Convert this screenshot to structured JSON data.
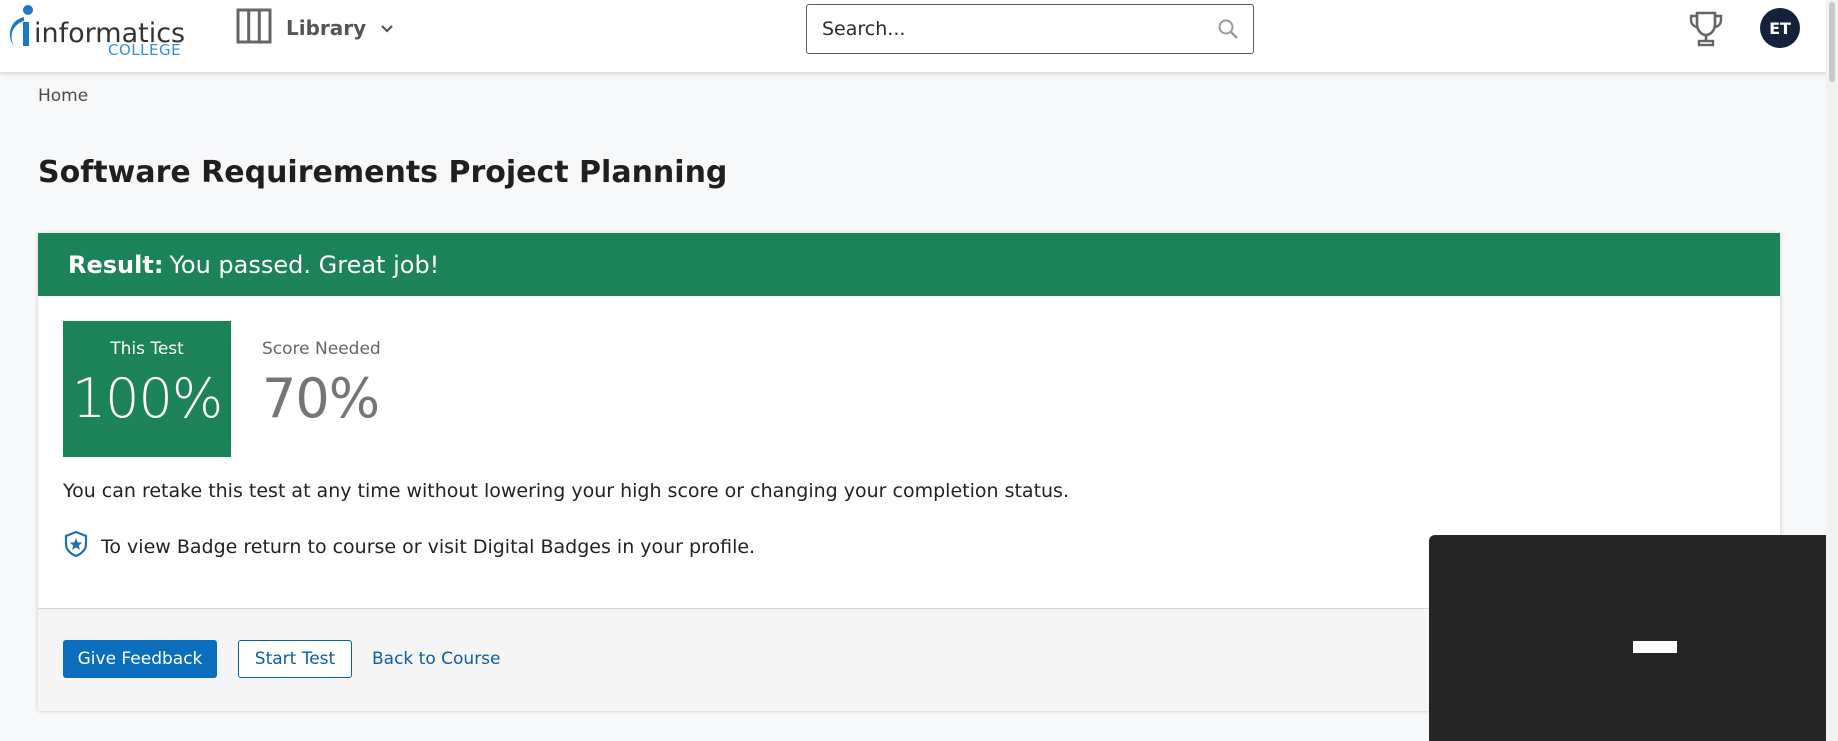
{
  "header": {
    "logo": {
      "primary": "informatics",
      "secondary": "COLLEGE"
    },
    "library_label": "Library",
    "search": {
      "placeholder": "Search...",
      "value": ""
    },
    "avatar_initials": "ET"
  },
  "breadcrumb": {
    "home": "Home"
  },
  "page": {
    "title": "Software Requirements Project Planning"
  },
  "result": {
    "label": "Result:",
    "message": "You passed. Great job!",
    "this_test": {
      "caption": "This Test",
      "value": "100%"
    },
    "score_needed": {
      "caption": "Score Needed",
      "value": "70%"
    },
    "retake_note": "You can retake this test at any time without lowering your high score or changing your completion status.",
    "badge_note": "To view Badge return to course or visit Digital Badges in your profile."
  },
  "actions": {
    "give_feedback": "Give Feedback",
    "start_test": "Start Test",
    "back_to_course": "Back to Course"
  },
  "colors": {
    "pass_green": "#1c8358",
    "primary_blue": "#0a6ebd",
    "link_blue": "#0a5fa8",
    "avatar_navy": "#14213d",
    "overlay_dark": "#262626"
  },
  "icons": {
    "library": "library-columns-icon",
    "chevron": "chevron-down-icon",
    "search": "search-icon",
    "trophy": "trophy-icon",
    "badge": "badge-shield-icon"
  }
}
